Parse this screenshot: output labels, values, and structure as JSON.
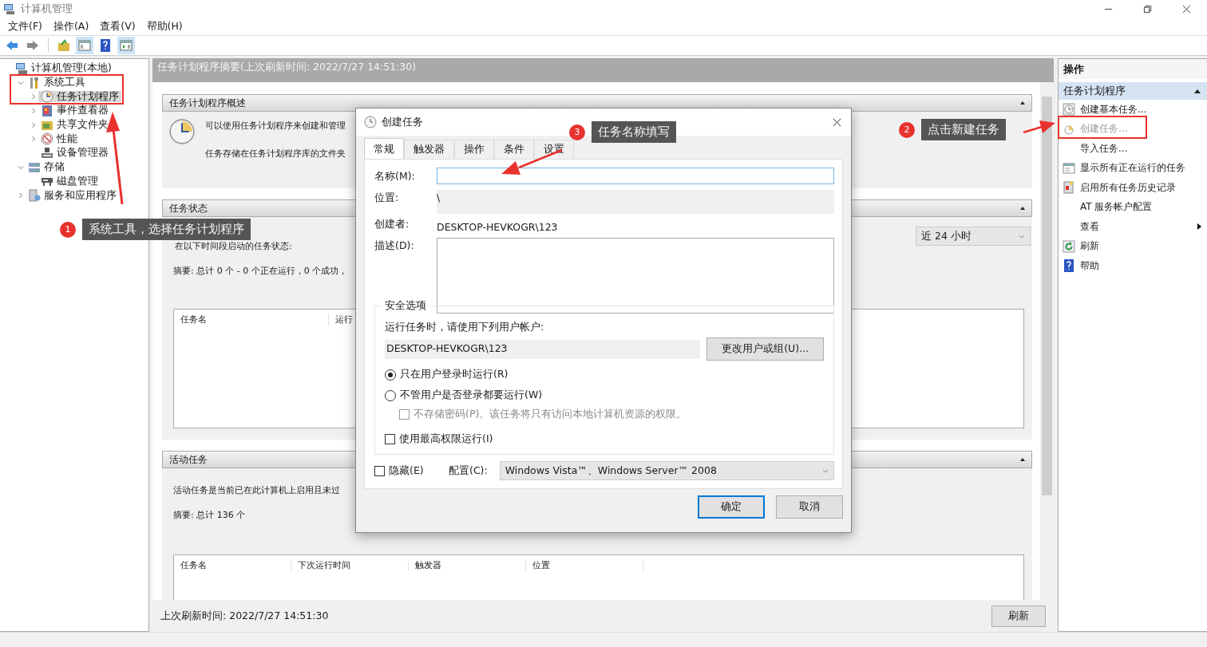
{
  "window": {
    "title": "计算机管理"
  },
  "menu": [
    "文件(F)",
    "操作(A)",
    "查看(V)",
    "帮助(H)"
  ],
  "tree": [
    {
      "label": "计算机管理(本地)",
      "selected": false,
      "children": [
        {
          "label": "系统工具",
          "expanded": true,
          "selected": false,
          "children": [
            {
              "label": "任务计划程序",
              "expanded": false,
              "selected": true
            },
            {
              "label": "事件查看器",
              "expanded": false,
              "selected": false
            },
            {
              "label": "共享文件夹",
              "expanded": false,
              "selected": false
            },
            {
              "label": "性能",
              "expanded": false,
              "selected": false
            },
            {
              "label": "设备管理器",
              "selected": false
            }
          ]
        },
        {
          "label": "存储",
          "expanded": true,
          "selected": false,
          "children": [
            {
              "label": "磁盘管理",
              "selected": false
            }
          ]
        },
        {
          "label": "服务和应用程序",
          "expanded": false,
          "selected": false
        }
      ]
    }
  ],
  "summary": {
    "header": "任务计划程序摘要(上次刷新时间: 2022/7/27 14:51:30)",
    "overview": {
      "title": "任务计划程序概述",
      "lines": [
        "可以使用任务计划程序来创建和管理",
        "任务存储在任务计划程序库的文件夹"
      ]
    },
    "status": {
      "title": "任务状态",
      "caption": "在以下时间段启动的任务状态:",
      "period": "近 24 小时",
      "summary": "摘要: 总计 0 个 - 0 个正在运行，0 个成功，",
      "columns": [
        "任务名",
        "运行"
      ]
    },
    "active": {
      "title": "活动任务",
      "caption": "活动任务是当前已在此计算机上启用且未过",
      "summary": "摘要: 总计 136 个",
      "columns": [
        "任务名",
        "下次运行时间",
        "触发器",
        "位置"
      ]
    },
    "footer": {
      "text": "上次刷新时间: 2022/7/27 14:51:30",
      "button": "刷新"
    }
  },
  "actions": {
    "title": "操作",
    "group": "任务计划程序",
    "items": [
      {
        "label": "创建基本任务...",
        "disabled": false,
        "submenu": false
      },
      {
        "label": "创建任务...",
        "disabled": true,
        "submenu": false
      },
      {
        "label": "导入任务...",
        "disabled": false,
        "submenu": false
      },
      {
        "label": "显示所有正在运行的任务",
        "disabled": false,
        "submenu": false
      },
      {
        "label": "启用所有任务历史记录",
        "disabled": false,
        "submenu": false
      },
      {
        "label": "AT 服务帐户配置",
        "disabled": false,
        "submenu": false
      },
      {
        "label": "查看",
        "disabled": false,
        "submenu": true
      },
      {
        "label": "刷新",
        "disabled": false,
        "submenu": false
      },
      {
        "label": "帮助",
        "disabled": false,
        "submenu": false
      }
    ]
  },
  "dialog": {
    "title": "创建任务",
    "tabs": [
      {
        "label": "常规",
        "selected": true
      },
      {
        "label": "触发器",
        "selected": false
      },
      {
        "label": "操作",
        "selected": false
      },
      {
        "label": "条件",
        "selected": false
      },
      {
        "label": "设置",
        "selected": false
      }
    ],
    "name": {
      "label": "名称(M):"
    },
    "location": {
      "label": "位置:",
      "value": "\\"
    },
    "author": {
      "label": "创建者:",
      "value": "DESKTOP-HEVKOGR\\123"
    },
    "description": {
      "label": "描述(D):"
    },
    "security": {
      "title": "安全选项",
      "prompt": "运行任务时，请使用下列用户帐户:",
      "account": "DESKTOP-HEVKOGR\\123",
      "change_button": "更改用户或组(U)...",
      "options": [
        {
          "kind": "radio",
          "label": "只在用户登录时运行(R)",
          "checked": true,
          "disabled": false
        },
        {
          "kind": "radio",
          "label": "不管用户是否登录都要运行(W)",
          "checked": false,
          "disabled": false,
          "children": [
            {
              "kind": "checkbox",
              "label": "不存储密码(P)。该任务将只有访问本地计算机资源的权限。",
              "checked": false,
              "disabled": true
            }
          ]
        },
        {
          "kind": "checkbox",
          "label": "使用最高权限运行(I)",
          "checked": false,
          "disabled": false
        }
      ]
    },
    "hidden": {
      "label": "隐藏(E)",
      "checked": false
    },
    "config": {
      "label": "配置(C):",
      "value": "Windows Vista™、Windows Server™ 2008"
    },
    "buttons": [
      {
        "label": "确定",
        "default": true
      },
      {
        "label": "取消",
        "default": false
      }
    ]
  },
  "annotations": [
    {
      "number": "1",
      "text": "系统工具，选择任务计划程序"
    },
    {
      "number": "3",
      "text": "任务名称填写"
    },
    {
      "number": "2",
      "text": "点击新建任务"
    }
  ]
}
